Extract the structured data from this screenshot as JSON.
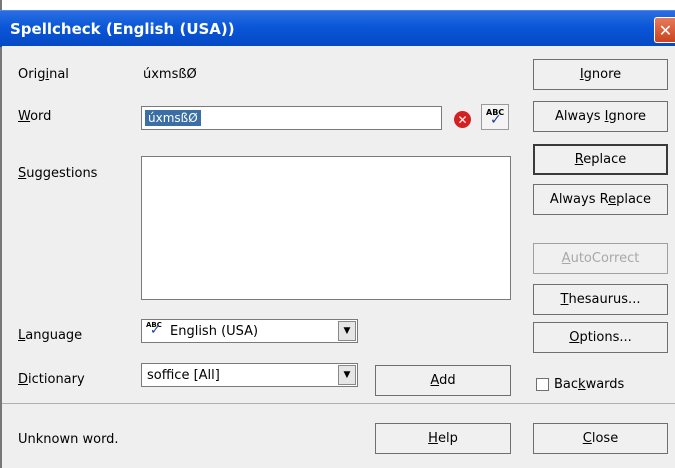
{
  "window": {
    "title": "Spellcheck (English (USA))",
    "close_glyph": "✕"
  },
  "labels": {
    "original": "Original",
    "word": "Word",
    "suggestions": "Suggestions",
    "language": "Language",
    "dictionary": "Dictionary"
  },
  "original_value": "úxmsßØ",
  "word_value": "úxmsßØ",
  "suggestions": [],
  "language": {
    "selected": "English (USA)",
    "icon": "spellcheck-abc-icon"
  },
  "dictionary": {
    "selected": "soffice [All]"
  },
  "buttons": {
    "ignore": "Ignore",
    "always_ignore": "Always Ignore",
    "replace": "Replace",
    "always_replace": "Always Replace",
    "autocorrect": "AutoCorrect",
    "thesaurus": "Thesaurus...",
    "options": "Options...",
    "add": "Add",
    "help": "Help",
    "close": "Close"
  },
  "backwards_label": "Backwards",
  "backwards_checked": false,
  "status": "Unknown word.",
  "colors": {
    "title_bar": "#0a56d8",
    "selection": "#3a6ea5",
    "error": "#d32020"
  }
}
